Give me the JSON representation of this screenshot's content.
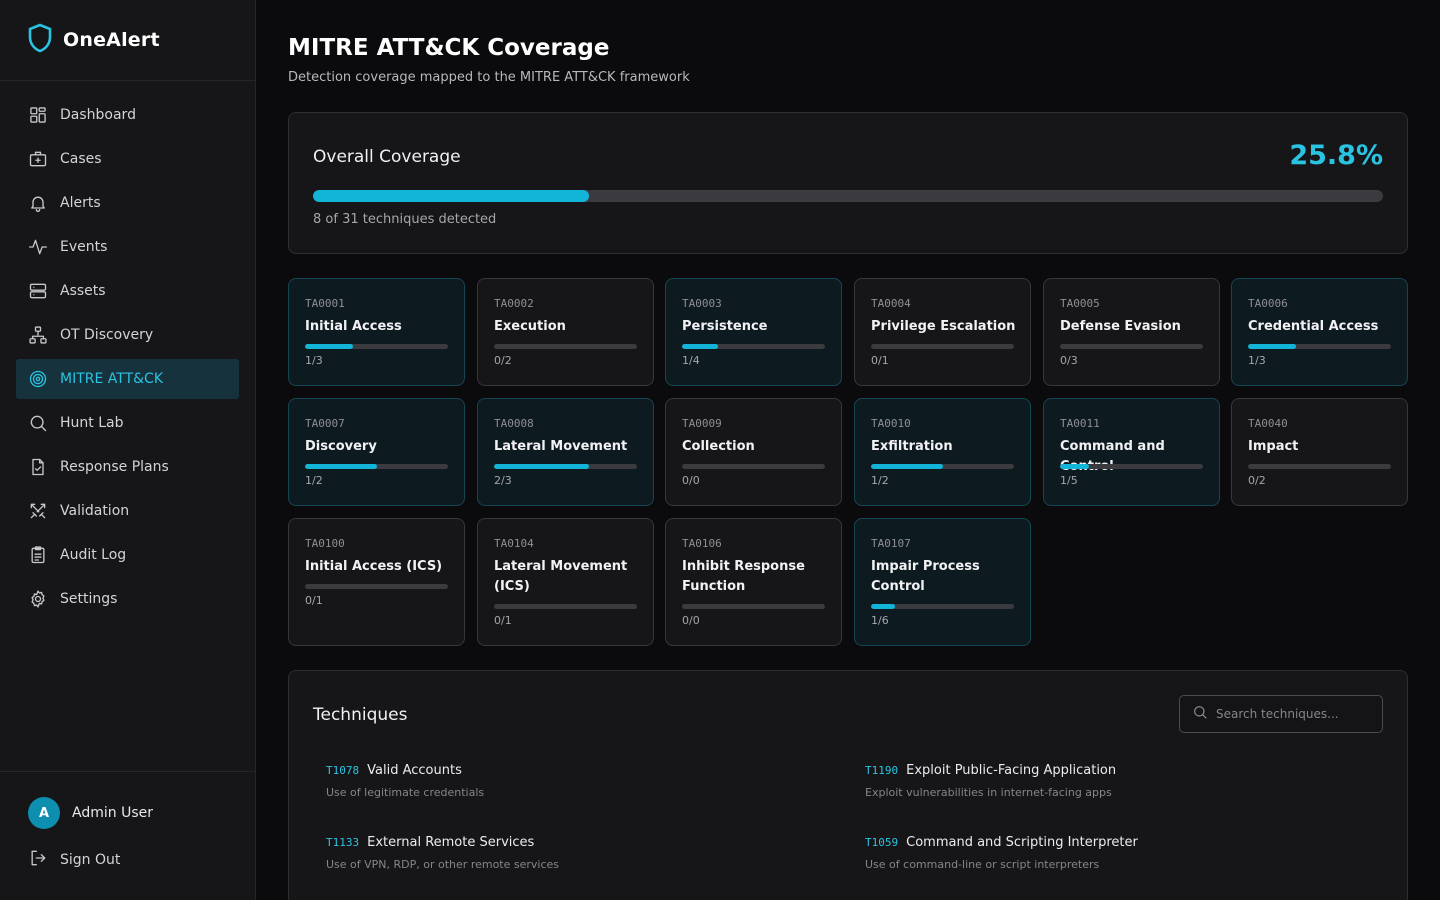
{
  "app": {
    "name": "OneAlert",
    "brand_color": "#2bc3e2"
  },
  "sidebar": {
    "items": [
      {
        "label": "Dashboard",
        "icon": "dashboard-icon"
      },
      {
        "label": "Cases",
        "icon": "briefcase-icon"
      },
      {
        "label": "Alerts",
        "icon": "bell-icon"
      },
      {
        "label": "Events",
        "icon": "activity-icon"
      },
      {
        "label": "Assets",
        "icon": "server-icon"
      },
      {
        "label": "OT Discovery",
        "icon": "network-icon"
      },
      {
        "label": "MITRE ATT&CK",
        "icon": "target-icon",
        "active": true
      },
      {
        "label": "Hunt Lab",
        "icon": "search-icon"
      },
      {
        "label": "Response Plans",
        "icon": "file-check-icon"
      },
      {
        "label": "Validation",
        "icon": "swords-icon"
      },
      {
        "label": "Audit Log",
        "icon": "clipboard-icon"
      },
      {
        "label": "Settings",
        "icon": "gear-icon"
      }
    ],
    "user": {
      "initial": "A",
      "name": "Admin User"
    },
    "sign_out": "Sign Out"
  },
  "header": {
    "title": "MITRE ATT&CK Coverage",
    "subtitle": "Detection coverage mapped to the MITRE ATT&CK framework"
  },
  "overall": {
    "title": "Overall Coverage",
    "percent": "25.8%",
    "fraction": 0.258,
    "summary": "8 of 31 techniques detected"
  },
  "tactics": [
    {
      "id": "TA0001",
      "name": "Initial Access",
      "detected": 1,
      "total": 3,
      "count": "1/3"
    },
    {
      "id": "TA0002",
      "name": "Execution",
      "detected": 0,
      "total": 2,
      "count": "0/2"
    },
    {
      "id": "TA0003",
      "name": "Persistence",
      "detected": 1,
      "total": 4,
      "count": "1/4"
    },
    {
      "id": "TA0004",
      "name": "Privilege Escalation",
      "detected": 0,
      "total": 1,
      "count": "0/1"
    },
    {
      "id": "TA0005",
      "name": "Defense Evasion",
      "detected": 0,
      "total": 3,
      "count": "0/3"
    },
    {
      "id": "TA0006",
      "name": "Credential Access",
      "detected": 1,
      "total": 3,
      "count": "1/3"
    },
    {
      "id": "TA0007",
      "name": "Discovery",
      "detected": 1,
      "total": 2,
      "count": "1/2"
    },
    {
      "id": "TA0008",
      "name": "Lateral Movement",
      "detected": 2,
      "total": 3,
      "count": "2/3"
    },
    {
      "id": "TA0009",
      "name": "Collection",
      "detected": 0,
      "total": 0,
      "count": "0/0"
    },
    {
      "id": "TA0010",
      "name": "Exfiltration",
      "detected": 1,
      "total": 2,
      "count": "1/2"
    },
    {
      "id": "TA0011",
      "name": "Command and Control",
      "detected": 1,
      "total": 5,
      "count": "1/5"
    },
    {
      "id": "TA0040",
      "name": "Impact",
      "detected": 0,
      "total": 2,
      "count": "0/2"
    },
    {
      "id": "TA0100",
      "name": "Initial Access (ICS)",
      "detected": 0,
      "total": 1,
      "count": "0/1"
    },
    {
      "id": "TA0104",
      "name": "Lateral Movement (ICS)",
      "detected": 0,
      "total": 1,
      "count": "0/1"
    },
    {
      "id": "TA0106",
      "name": "Inhibit Response Function",
      "detected": 0,
      "total": 0,
      "count": "0/0"
    },
    {
      "id": "TA0107",
      "name": "Impair Process Control",
      "detected": 1,
      "total": 6,
      "count": "1/6"
    }
  ],
  "techniques": {
    "title": "Techniques",
    "search_placeholder": "Search techniques...",
    "items": [
      {
        "id": "T1078",
        "name": "Valid Accounts",
        "desc": "Use of legitimate credentials"
      },
      {
        "id": "T1190",
        "name": "Exploit Public-Facing Application",
        "desc": "Exploit vulnerabilities in internet-facing apps"
      },
      {
        "id": "T1133",
        "name": "External Remote Services",
        "desc": "Use of VPN, RDP, or other remote services"
      },
      {
        "id": "T1059",
        "name": "Command and Scripting Interpreter",
        "desc": "Use of command-line or script interpreters"
      }
    ]
  }
}
